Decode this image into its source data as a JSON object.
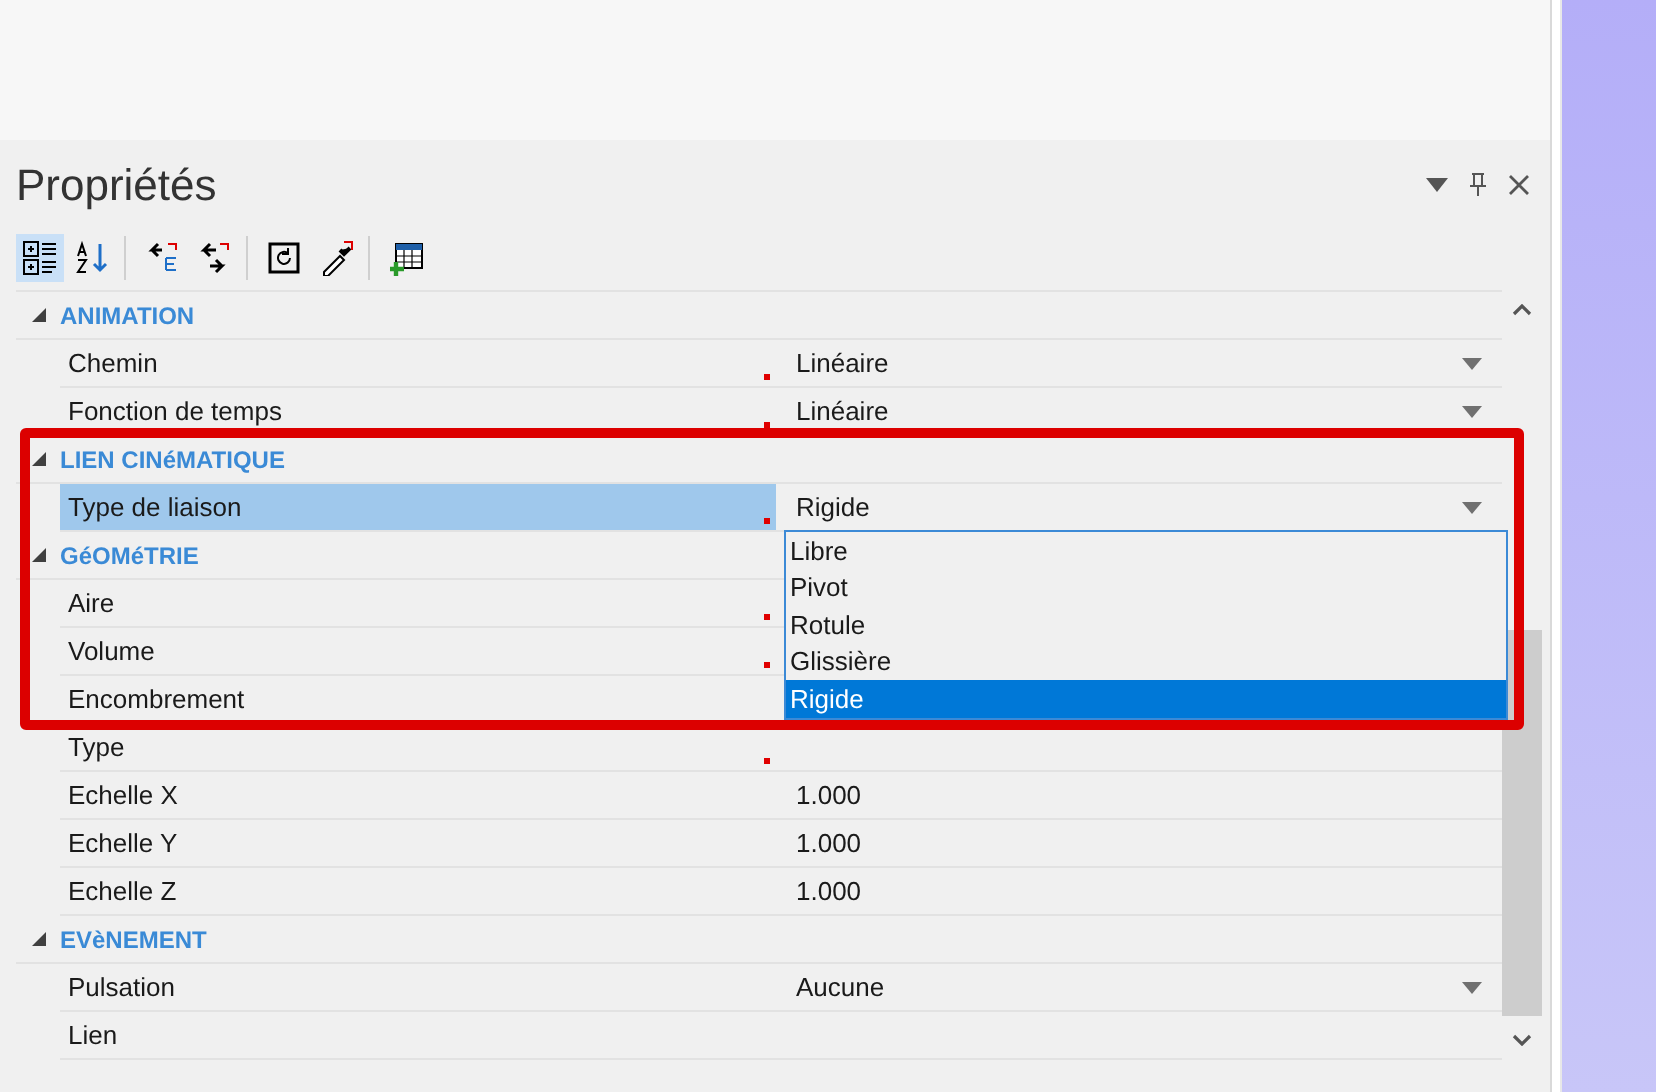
{
  "panel": {
    "title": "Propriétés"
  },
  "toolbar": [
    {
      "kind": "categorized",
      "selected": true
    },
    {
      "kind": "alphabetical",
      "selected": false
    },
    {
      "kind": "arrow-box",
      "selected": false
    },
    {
      "kind": "arrows",
      "selected": false
    },
    {
      "kind": "refresh",
      "selected": false
    },
    {
      "kind": "eyedropper",
      "selected": false
    },
    {
      "kind": "grid-add",
      "selected": false
    }
  ],
  "grid": {
    "categories": [
      {
        "name": "ANIMATION",
        "expanded": true,
        "properties": [
          {
            "name": "Chemin",
            "value": "Linéaire",
            "dropdown": true,
            "marked": true,
            "selected": false
          },
          {
            "name": "Fonction de temps",
            "value": "Linéaire",
            "dropdown": true,
            "marked": true,
            "selected": false
          }
        ]
      },
      {
        "name": "LIEN CINéMATIQUE",
        "expanded": true,
        "properties": [
          {
            "name": "Type de liaison",
            "value": "Rigide",
            "dropdown": true,
            "marked": true,
            "selected": true
          }
        ]
      },
      {
        "name": "GéOMéTRIE",
        "expanded": true,
        "properties": [
          {
            "name": "Aire",
            "dropdown": false,
            "marked": true,
            "selected": false
          },
          {
            "name": "Volume",
            "dropdown": false,
            "marked": true,
            "selected": false
          },
          {
            "name": "Encombrement",
            "dropdown": false,
            "marked": false,
            "selected": false
          },
          {
            "name": "Type",
            "dropdown": false,
            "marked": true,
            "selected": false
          },
          {
            "name": "Echelle X",
            "value": "1.000",
            "dropdown": false,
            "marked": false,
            "selected": false
          },
          {
            "name": "Echelle Y",
            "value": "1.000",
            "dropdown": false,
            "marked": false,
            "selected": false
          },
          {
            "name": "Echelle Z",
            "value": "1.000",
            "dropdown": false,
            "marked": false,
            "selected": false
          }
        ]
      },
      {
        "name": "EVèNEMENT",
        "expanded": true,
        "properties": [
          {
            "name": "Pulsation",
            "value": "Aucune",
            "dropdown": true,
            "marked": false,
            "selected": false
          },
          {
            "name": "Lien",
            "dropdown": false,
            "marked": false,
            "selected": false
          }
        ]
      }
    ]
  },
  "dropdown_list": {
    "items": [
      {
        "label": "Libre",
        "selected": false
      },
      {
        "label": "Pivot",
        "selected": false
      },
      {
        "label": "Rotule",
        "selected": false
      },
      {
        "label": "Glissière",
        "selected": false
      },
      {
        "label": "Rigide",
        "selected": true
      }
    ]
  }
}
